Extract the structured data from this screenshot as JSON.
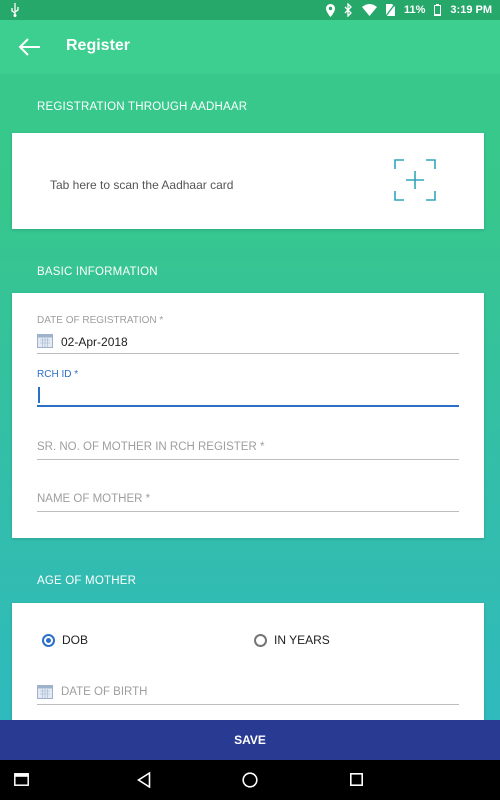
{
  "status_bar": {
    "battery": "11%",
    "time": "3:19 PM",
    "icons": [
      "usb-icon",
      "location-icon",
      "bluetooth-icon",
      "wifi-icon",
      "no-sim-icon",
      "battery-icon"
    ]
  },
  "app_bar": {
    "title": "Register",
    "back_icon": "arrow-left-icon"
  },
  "aadhaar_section": {
    "label": "REGISTRATION THROUGH AADHAAR",
    "scan_text": "Tab here to scan the Aadhaar card",
    "scan_icon": "scan-plus-icon"
  },
  "basic_info": {
    "label": "BASIC INFORMATION",
    "date_of_registration": {
      "label": "DATE OF REGISTRATION *",
      "value": "02-Apr-2018"
    },
    "rch_id": {
      "label": "RCH ID *",
      "value": ""
    },
    "sr_no": {
      "placeholder": "SR. NO. OF MOTHER IN RCH REGISTER *"
    },
    "name_of_mother": {
      "placeholder": "NAME OF MOTHER *"
    }
  },
  "age_section": {
    "label": "AGE OF MOTHER",
    "options": [
      {
        "label": "DOB",
        "selected": true
      },
      {
        "label": "IN YEARS",
        "selected": false
      }
    ],
    "dob_placeholder": "DATE OF BIRTH"
  },
  "save_label": "SAVE",
  "colors": {
    "accent": "#2b6fc6",
    "save_bar": "#293a93",
    "app_bar": "#3ccf8f"
  }
}
